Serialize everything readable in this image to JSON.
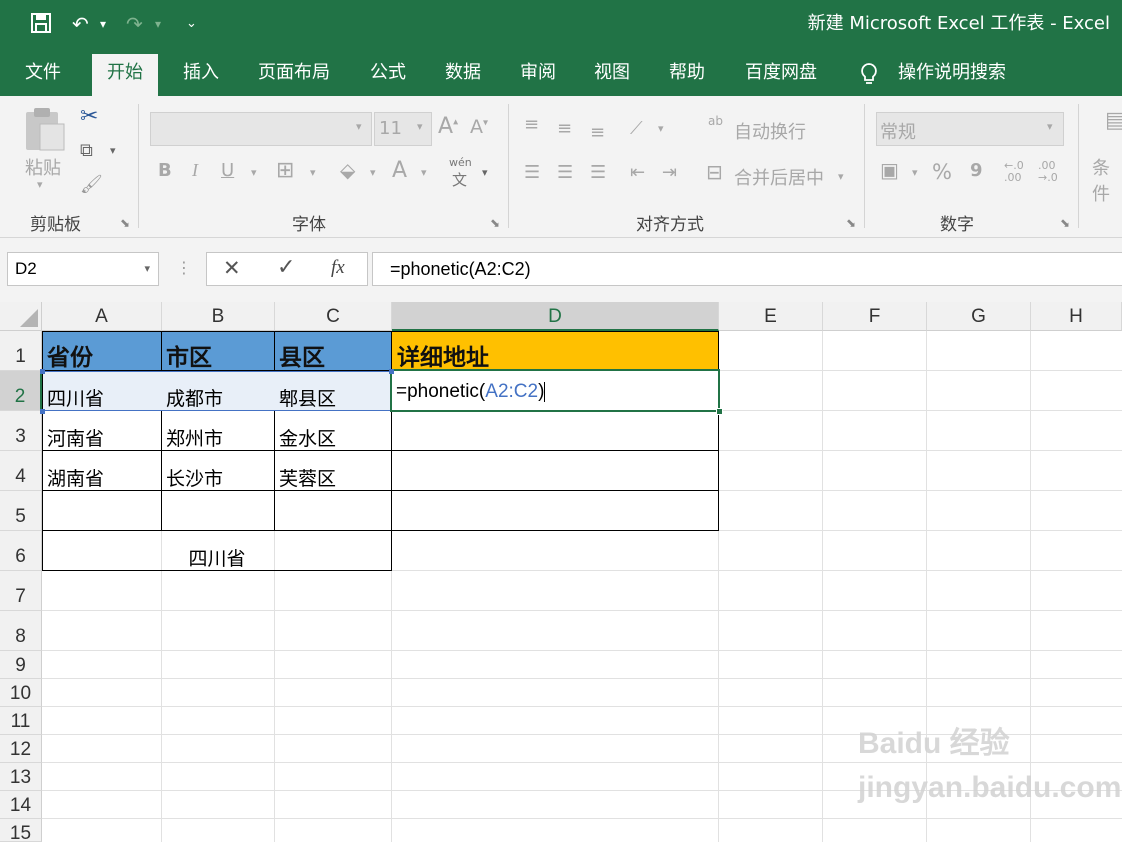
{
  "window": {
    "title": "新建 Microsoft Excel 工作表  -  Excel"
  },
  "quick_access": {
    "save_icon": "save-icon",
    "undo_icon": "undo-icon",
    "redo_icon": "redo-icon",
    "customize_icon": "customize-qat-icon"
  },
  "ribbon_tabs": [
    "文件",
    "开始",
    "插入",
    "页面布局",
    "公式",
    "数据",
    "审阅",
    "视图",
    "帮助",
    "百度网盘"
  ],
  "active_tab": "开始",
  "tell_me": "操作说明搜索",
  "ribbon": {
    "clipboard": {
      "label": "剪贴板",
      "paste": "粘贴"
    },
    "font": {
      "label": "字体",
      "size": "11",
      "bold": "B",
      "italic": "I",
      "underline": "U",
      "phonetic_top": "wén",
      "phonetic_bottom": "文"
    },
    "alignment": {
      "label": "对齐方式",
      "wrap_text": "自动换行",
      "merge_center": "合并后居中",
      "wrap_glyph": "ab"
    },
    "number": {
      "label": "数字",
      "format": "常规",
      "percent": "%",
      "comma": "9",
      "inc_decimal": "←.0 .00",
      "dec_decimal": ".00 →.0"
    },
    "styles": {
      "conditional": "条件"
    }
  },
  "formula_bar": {
    "name_box": "D2",
    "formula": "=phonetic(A2:C2)",
    "fx": "fx",
    "cancel": "✕",
    "enter": "✓"
  },
  "columns": [
    "A",
    "B",
    "C",
    "D",
    "E",
    "F",
    "G",
    "H"
  ],
  "rows": [
    "1",
    "2",
    "3",
    "4",
    "5",
    "6",
    "7",
    "8",
    "9",
    "10",
    "11",
    "12",
    "13",
    "14",
    "15"
  ],
  "cells": {
    "A1": "省份",
    "B1": "市区",
    "C1": "县区",
    "D1": "详细地址",
    "A2": "四川省",
    "B2": "成都市",
    "C2": "郫县区",
    "A3": "河南省",
    "B3": "郑州市",
    "C3": "金水区",
    "A4": "湖南省",
    "B4": "长沙市",
    "C4": "芙蓉区",
    "A6": "四川省"
  },
  "edit": {
    "prefix": "=phonetic(",
    "ref": "A2:C2",
    "suffix": ")"
  },
  "colors": {
    "accent": "#217346",
    "header_blue": "#5b9bd5",
    "header_gold": "#ffc000",
    "ref_blue": "#4472c4"
  },
  "watermark": "Baidu 经验 jingyan.baidu.com"
}
